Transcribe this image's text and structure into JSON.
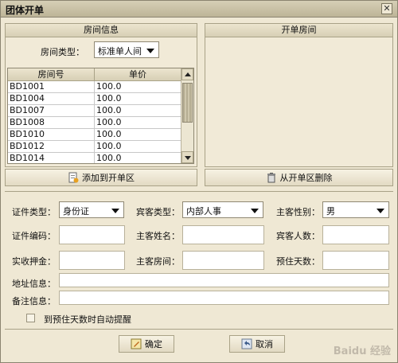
{
  "window": {
    "title": "团体开单",
    "close_glyph": "✕"
  },
  "room_info": {
    "header": "房间信息",
    "type_label": "房间类型：",
    "type_value": "标准单人间",
    "columns": [
      "房间号",
      "单价"
    ],
    "rows": [
      [
        "BD1001",
        "100.0"
      ],
      [
        "BD1004",
        "100.0"
      ],
      [
        "BD1007",
        "100.0"
      ],
      [
        "BD1008",
        "100.0"
      ],
      [
        "BD1010",
        "100.0"
      ],
      [
        "BD1012",
        "100.0"
      ],
      [
        "BD1014",
        "100.0"
      ]
    ],
    "add_button": "添加到开单区"
  },
  "open_rooms": {
    "header": "开单房间",
    "remove_button": "从开单区删除"
  },
  "form": {
    "id_type_label": "证件类型：",
    "id_type_value": "身份证",
    "guest_type_label": "宾客类型：",
    "guest_type_value": "内部人事",
    "gender_label": "主客性别：",
    "gender_value": "男",
    "id_number_label": "证件编码：",
    "guest_name_label": "主客姓名：",
    "guest_count_label": "宾客人数：",
    "deposit_label": "实收押金：",
    "guest_room_label": "主客房间：",
    "stay_days_label": "预住天数：",
    "address_label": "地址信息：",
    "note_label": "备注信息：",
    "remind_label": "到预住天数时自动提醒"
  },
  "actions": {
    "confirm": "确定",
    "cancel": "取消"
  },
  "watermark": "Baidu 经验"
}
